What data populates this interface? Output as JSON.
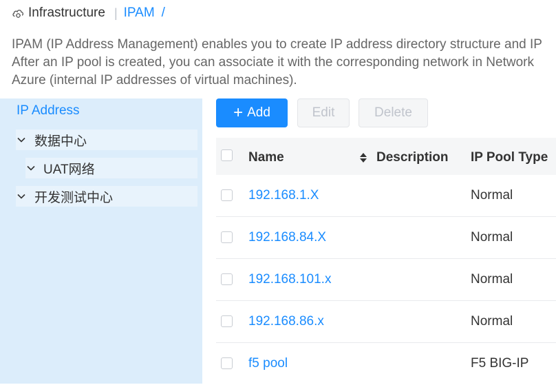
{
  "breadcrumb": {
    "root": "Infrastructure",
    "separator": "|",
    "current": "IPAM",
    "trailing": "/"
  },
  "description": {
    "line1": "IPAM (IP Address Management) enables you to create IP address directory structure and IP",
    "line2": "After an IP pool is created, you can associate it with the corresponding network in Network",
    "line3": "Azure (internal IP addresses of virtual machines)."
  },
  "sidebar": {
    "root_label": "IP Address",
    "nodes": [
      {
        "label": "数据中心",
        "icon": "chevron-down-icon"
      },
      {
        "label": "UAT网络",
        "icon": "chevron-down-icon"
      },
      {
        "label": "开发测试中心",
        "icon": "chevron-down-icon"
      }
    ]
  },
  "toolbar": {
    "add_icon": "+",
    "add_label": "Add",
    "edit_label": "Edit",
    "delete_label": "Delete"
  },
  "table": {
    "columns": {
      "name": "Name",
      "description": "Description",
      "ip_pool_type": "IP Pool Type"
    },
    "rows": [
      {
        "name": "192.168.1.X",
        "description": "",
        "type": "Normal"
      },
      {
        "name": "192.168.84.X",
        "description": "",
        "type": "Normal"
      },
      {
        "name": "192.168.101.x",
        "description": "",
        "type": "Normal"
      },
      {
        "name": "192.168.86.x",
        "description": "",
        "type": "Normal"
      },
      {
        "name": "f5 pool",
        "description": "",
        "type": "F5 BIG-IP"
      }
    ]
  },
  "colors": {
    "accent": "#1a8cff",
    "sidebar_bg": "#dcedfb",
    "header_bg": "#f5f6f7"
  }
}
